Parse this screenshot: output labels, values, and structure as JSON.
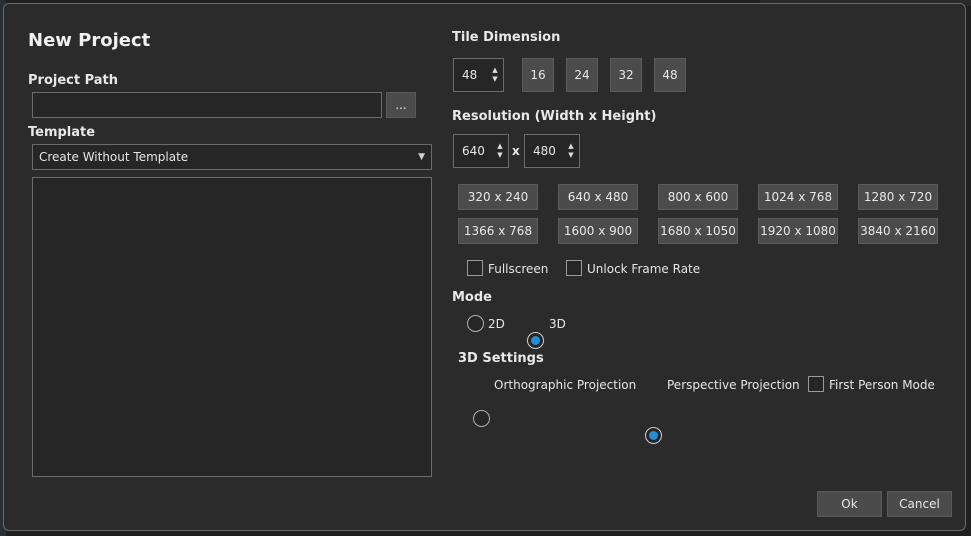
{
  "dialog": {
    "title": "New Project",
    "project_path": {
      "label": "Project Path",
      "value": "",
      "browse_label": "..."
    },
    "template": {
      "label": "Template",
      "selected": "Create Without Template"
    },
    "tile_dimension": {
      "label": "Tile Dimension",
      "value": "48",
      "presets": [
        "16",
        "24",
        "32",
        "48"
      ]
    },
    "resolution": {
      "label": "Resolution (Width x Height)",
      "width": "640",
      "separator": "x",
      "height": "480",
      "presets": [
        "320 x 240",
        "640 x 480",
        "800 x 600",
        "1024 x 768",
        "1280 x 720",
        "1366 x 768",
        "1600 x 900",
        "1680 x 1050",
        "1920 x 1080",
        "3840 x 2160"
      ],
      "fullscreen_label": "Fullscreen",
      "fullscreen_checked": false,
      "unlock_frame_rate_label": "Unlock Frame Rate",
      "unlock_frame_rate_checked": false
    },
    "mode": {
      "label": "Mode",
      "options": [
        "2D",
        "3D"
      ],
      "selected": "3D"
    },
    "settings_3d": {
      "label": "3D Settings",
      "orthographic_label": "Orthographic Projection",
      "perspective_label": "Perspective Projection",
      "projection_selected": "Perspective Projection",
      "first_person_label": "First Person Mode",
      "first_person_checked": false
    },
    "ok_label": "Ok",
    "cancel_label": "Cancel"
  },
  "colors": {
    "accent": "#1e90d6",
    "background": "#2b2b2b",
    "button": "#4b4b4b"
  }
}
